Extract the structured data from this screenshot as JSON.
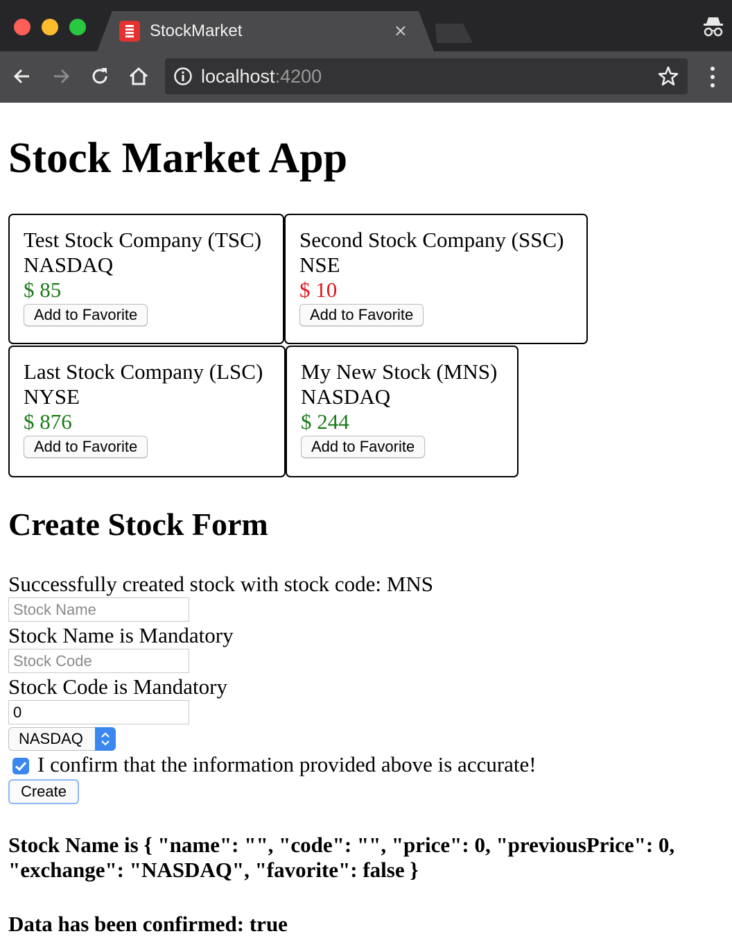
{
  "browser": {
    "tab_title": "StockMarket",
    "tab_close": "×",
    "url_host": "localhost",
    "url_port": ":4200"
  },
  "page": {
    "title": "Stock Market App",
    "add_to_favorite_label": "Add to Favorite"
  },
  "stocks": [
    {
      "name": "Test Stock Company (TSC)",
      "exchange": "NASDAQ",
      "price": "$ 85",
      "trend": "up"
    },
    {
      "name": "Second Stock Company (SSC)",
      "exchange": "NSE",
      "price": "$ 10",
      "trend": "down"
    },
    {
      "name": "Last Stock Company (LSC)",
      "exchange": "NYSE",
      "price": "$ 876",
      "trend": "up"
    },
    {
      "name": "My New Stock (MNS)",
      "exchange": "NASDAQ",
      "price": "$ 244",
      "trend": "up"
    }
  ],
  "form": {
    "title": "Create Stock Form",
    "success_message": "Successfully created stock with stock code: MNS",
    "name_placeholder": "Stock Name",
    "name_error": "Stock Name is Mandatory",
    "code_placeholder": "Stock Code",
    "code_error": "Stock Code is Mandatory",
    "price_value": "0",
    "exchange_selected": "NASDAQ",
    "confirm_label": "I confirm that the information provided above is accurate!",
    "confirm_checked": true,
    "create_label": "Create",
    "json_output": "Stock Name is { \"name\": \"\", \"code\": \"\", \"price\": 0, \"previousPrice\": 0, \"exchange\": \"NASDAQ\", \"favorite\": false }",
    "confirmed_text": "Data has been confirmed: true"
  },
  "colors": {
    "price_up": "#1a7a1a",
    "price_down": "#e0161b",
    "accent": "#3b87f0"
  }
}
